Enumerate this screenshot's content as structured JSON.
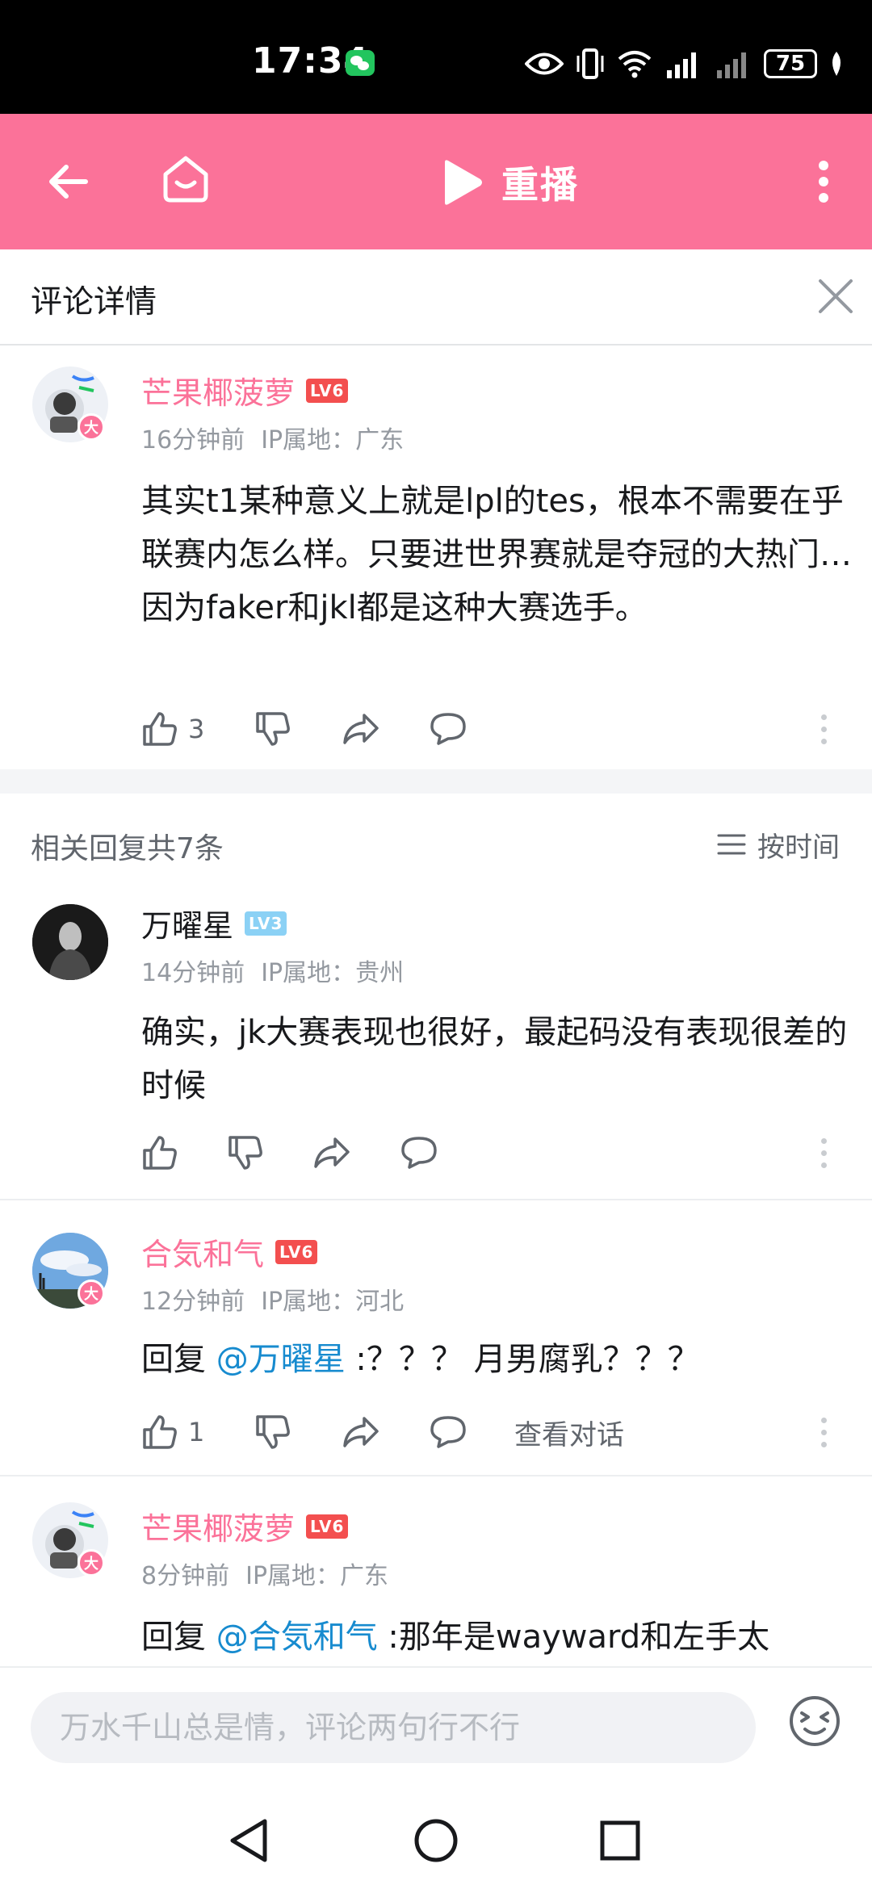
{
  "status_bar": {
    "time": "17:34",
    "battery": "75"
  },
  "header": {
    "replay_label": "重播"
  },
  "detail": {
    "title": "评论详情"
  },
  "main_comment": {
    "username": "芒果椰菠萝",
    "level": "LV6",
    "badge": "大",
    "time": "16分钟前",
    "ip": "IP属地：广东",
    "content": "其实t1某种意义上就是lpl的tes，根本不需要在乎联赛内怎么样。只要进世界赛就是夺冠的大热门…因为faker和jkl都是这种大赛选手。",
    "likes": "3"
  },
  "replies_header": {
    "count": "相关回复共7条",
    "sort_label": "按时间"
  },
  "replies": [
    {
      "username": "万曜星",
      "level": "LV3",
      "time": "14分钟前",
      "ip": "IP属地：贵州",
      "content": "确实，jk大赛表现也很好，最起码没有表现很差的时候"
    },
    {
      "username": "合気和气",
      "level": "LV6",
      "badge": "大",
      "time": "12分钟前",
      "ip": "IP属地：河北",
      "reply_prefix": "回复 ",
      "mention": "@万曜星",
      "content": " :？？？ 月男腐乳？？？",
      "likes": "1",
      "view_dialog": "查看对话"
    },
    {
      "username": "芒果椰菠萝",
      "level": "LV6",
      "badge": "大",
      "time": "8分钟前",
      "ip": "IP属地：广东",
      "reply_prefix": "回复 ",
      "mention": "@合気和气",
      "content": " :那年是wayward和左手太"
    }
  ],
  "input": {
    "placeholder": "万水千山总是情，评论两句行不行"
  },
  "colors": {
    "brand_pink": "#fb7299",
    "mention_blue": "#178bcf",
    "level_red": "#f34f4f",
    "level_blue": "#8bd1f5"
  }
}
